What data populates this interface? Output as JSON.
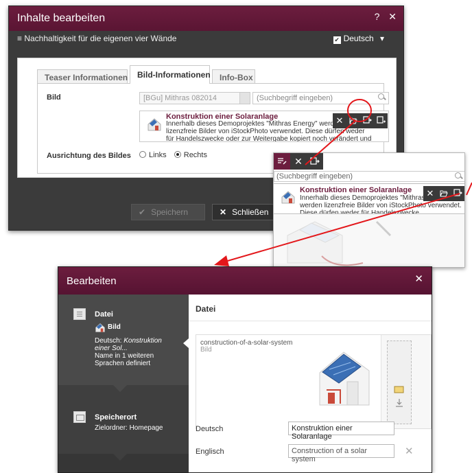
{
  "dialog1": {
    "title": "Inhalte bearbeiten",
    "help": "?",
    "close": "✕",
    "subtitle": "≡ Nachhaltigkeit für die eigenen vier Wände",
    "language": "Deutsch",
    "language_caret": "▾",
    "tabs": [
      {
        "label": "Teaser Informationen",
        "active": false
      },
      {
        "label": "Bild-Informationen",
        "active": true
      },
      {
        "label": "Info-Box",
        "active": false
      }
    ],
    "image_label": "Bild",
    "image_select": "[BGu] Mithras 082014",
    "search_placeholder": "(Suchbegriff eingeben)",
    "item": {
      "title": "Konstruktion einer Solaranlage",
      "desc": "Innerhalb dieses Demoprojektes \"Mithras Energy\" werden lizenzfreie Bilder von iStockPhoto verwendet. Diese dürfen weder für Handelszwecke oder zur Weitergabe kopiert noch verändert und"
    },
    "toolbar_icons": [
      "close-icon",
      "folder-open-icon",
      "edit-image-icon",
      "add-image-icon"
    ],
    "alignment": {
      "label": "Ausrichtung des Bildes",
      "options": [
        "Links",
        "Rechts"
      ],
      "selected": "Rechts"
    },
    "save_button": "Speichern",
    "close_button": "Schließen",
    "save_icon": "✔",
    "close_icon": "✕"
  },
  "zoom": {
    "search_placeholder": "(Suchbegriff eingeben)",
    "item_title": "Konstruktion einer Solaranlage",
    "item_desc": "Innerhalb dieses Demoprojektes \"Mithras Energy\" werden lizenzfreie Bilder von iStockPhoto verwendet. Diese dürfen weder für Handelszwecke"
  },
  "dialog2": {
    "title": "Bearbeiten",
    "close": "✕",
    "left": {
      "datei_title": "Datei",
      "datei_type": "Bild",
      "datei_lang_label": "Deutsch:",
      "datei_lang_value": "Konstruktion einer Sol...",
      "datei_note": "Name in 1 weiteren Sprachen definiert",
      "speicherort_title": "Speicherort",
      "speicherort_value": "Zielordner: Homepage"
    },
    "right": {
      "heading": "Datei",
      "file_name": "construction-of-a-solar-system",
      "file_type": "Bild",
      "rows": [
        {
          "label": "Deutsch",
          "value": "Konstruktion einer Solaranlage"
        },
        {
          "label": "Englisch",
          "value": "Construction of a solar system"
        }
      ],
      "remove": "✕"
    }
  },
  "colors": {
    "accent": "#6c1d3e",
    "arrow": "#e3171b"
  }
}
